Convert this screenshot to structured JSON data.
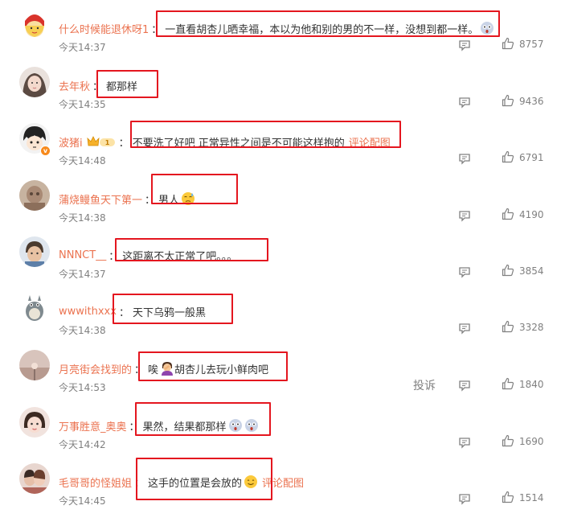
{
  "comments": [
    {
      "username": "什么时候能退休呀1",
      "text": "一直看胡杏儿晒幸福，本以为他和别的男的不一样，没想到都一样。",
      "trail_emoji": "shocked-face-emoji",
      "time": "今天14:37",
      "likes": "8757",
      "avatar_icon": "cartoon-girl-avatar"
    },
    {
      "username": "去年秋",
      "text": "都那样",
      "time": "今天14:35",
      "likes": "9436",
      "avatar_icon": "girl-photo-avatar"
    },
    {
      "username": "波猪i",
      "member_badge": "1",
      "text": "不要洗了好吧 正常异性之间是不可能这样抱的",
      "link_label": "评论配图",
      "time": "今天14:48",
      "likes": "6791",
      "avatar_icon": "anime-boy-avatar",
      "verified_icon": "verified-v-icon"
    },
    {
      "username": "蒲烧鳗鱼天下第一",
      "text": "男人",
      "trail_emoji": "sweat-face-emoji",
      "time": "今天14:38",
      "likes": "4190",
      "avatar_icon": "blurred-portrait-avatar"
    },
    {
      "username": "NNNCT__",
      "text": "这距离不太正常了吧。。。",
      "time": "今天14:37",
      "likes": "3854",
      "avatar_icon": "boy-photo-avatar"
    },
    {
      "username": "wwwithxxx",
      "text": "天下乌鸦一般黑",
      "time": "今天14:38",
      "likes": "3328",
      "avatar_icon": "totoro-avatar"
    },
    {
      "username": "月亮街会找到的",
      "text_before": "唉",
      "inline_emoji": "facepalm-person-emoji",
      "text": "胡杏儿去玩小鲜肉吧",
      "time": "今天14:53",
      "report_label": "投诉",
      "likes": "1840",
      "avatar_icon": "sunset-avatar"
    },
    {
      "username": "万事胜意_奥奥",
      "text": "果然，结果都那样",
      "trail_emoji": "shocked-face-emoji",
      "trail_emoji2": "shocked-face-emoji",
      "time": "今天14:42",
      "likes": "1690",
      "avatar_icon": "child-photo-avatar"
    },
    {
      "username": "毛哥哥的怪姐姐",
      "text": "这手的位置是会放的",
      "trail_emoji": "smile-face-emoji",
      "link_label": "评论配图",
      "time": "今天14:45",
      "likes": "1514",
      "avatar_icon": "couple-photo-avatar"
    }
  ],
  "colors": {
    "username": "#eb7350",
    "link": "#eb7350",
    "text": "#333333",
    "meta": "#808080",
    "highlight_box": "#e4161f",
    "verified": "#f78a1d"
  }
}
